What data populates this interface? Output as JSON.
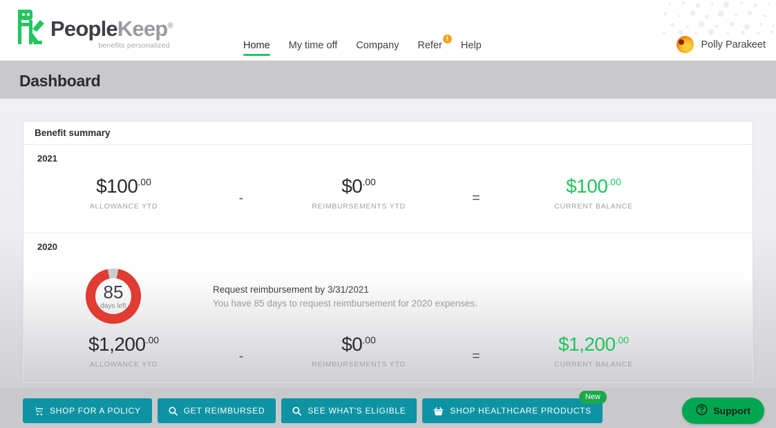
{
  "header": {
    "logo": {
      "mark": "pk-robot-logo",
      "word_people": "People",
      "word_keep": "Keep",
      "registered": "®",
      "tagline": "benefits personalized"
    },
    "nav": [
      {
        "label": "Home",
        "active": true,
        "badge": null
      },
      {
        "label": "My time off",
        "active": false,
        "badge": null
      },
      {
        "label": "Company",
        "active": false,
        "badge": "!"
      },
      {
        "label": "Refer",
        "active": false,
        "badge": "!"
      },
      {
        "label": "Help",
        "active": false,
        "badge": null
      }
    ],
    "user": {
      "name": "Polly Parakeet",
      "avatar": "parakeet-avatar"
    }
  },
  "page": {
    "title": "Dashboard"
  },
  "card": {
    "title": "Benefit summary",
    "years": [
      {
        "year": "2021",
        "allowance": {
          "amount": "$100",
          "cents": ".00",
          "label": "ALLOWANCE YTD"
        },
        "op1": "-",
        "reimbursements": {
          "amount": "$0",
          "cents": ".00",
          "label": "REIMBURSEMENTS YTD"
        },
        "op2": "=",
        "balance": {
          "amount": "$100",
          "cents": ".00",
          "label": "CURRENT BALANCE"
        }
      },
      {
        "year": "2020",
        "allowance": {
          "amount": "$1,200",
          "cents": ".00",
          "label": "ALLOWANCE YTD"
        },
        "op1": "-",
        "reimbursements": {
          "amount": "$0",
          "cents": ".00",
          "label": "REIMBURSEMENTS YTD"
        },
        "op2": "=",
        "balance": {
          "amount": "$1,200",
          "cents": ".00",
          "label": "CURRENT BALANCE"
        }
      }
    ],
    "reminder": {
      "days_number": "85",
      "days_sub": "days left",
      "title": "Request reimbursement by 3/31/2021",
      "body": "You have 85 days to request reimbursement for 2020 expenses."
    }
  },
  "actions": [
    {
      "label": "SHOP FOR A POLICY",
      "icon": "cart-icon",
      "badge": null
    },
    {
      "label": "GET REIMBURSED",
      "icon": "search-icon",
      "badge": null
    },
    {
      "label": "SEE WHAT'S ELIGIBLE",
      "icon": "search-icon",
      "badge": null
    },
    {
      "label": "SHOP HEALTHCARE PRODUCTS",
      "icon": "basket-icon",
      "badge": "New"
    }
  ],
  "support": {
    "label": "Support",
    "icon": "question-circle-icon"
  },
  "colors": {
    "brand_green": "#22c55e",
    "teal_button": "#0d93a3",
    "support_green": "#00a650",
    "donut_red": "#e03c31",
    "badge_orange": "#f4a522",
    "balance_green": "#22c45f"
  }
}
